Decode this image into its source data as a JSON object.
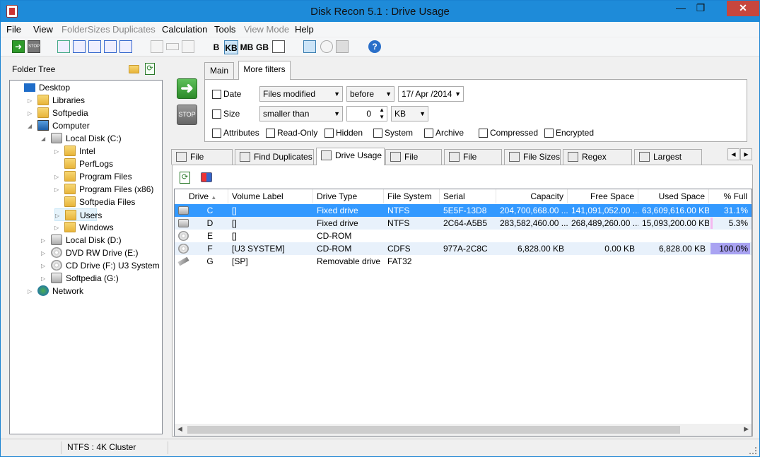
{
  "window": {
    "title": "Disk Recon 5.1 : Drive Usage"
  },
  "menu": [
    "File",
    "View",
    "FolderSizes",
    "Duplicates",
    "Calculation",
    "Tools",
    "View Mode",
    "Help"
  ],
  "menu_disabled": [
    false,
    false,
    true,
    true,
    false,
    false,
    true,
    false
  ],
  "toolbar": {
    "units": [
      "B",
      "KB",
      "MB",
      "GB"
    ],
    "active_unit": "KB"
  },
  "left": {
    "title": "Folder Tree",
    "tree": [
      {
        "label": "Desktop",
        "icon": "desktop-icon",
        "level": 0,
        "exp": ""
      },
      {
        "label": "Libraries",
        "icon": "folder-icon",
        "level": 1,
        "exp": "▷"
      },
      {
        "label": "Softpedia",
        "icon": "user-folder-icon",
        "level": 1,
        "exp": "▷"
      },
      {
        "label": "Computer",
        "icon": "computer-icon",
        "level": 1,
        "exp": "◢"
      },
      {
        "label": "Local Disk (C:)",
        "icon": "drive-icon",
        "level": 2,
        "exp": "◢"
      },
      {
        "label": "Intel",
        "icon": "folder-icon",
        "level": 3,
        "exp": "▷"
      },
      {
        "label": "PerfLogs",
        "icon": "folder-icon",
        "level": 3,
        "exp": ""
      },
      {
        "label": "Program Files",
        "icon": "folder-icon",
        "level": 3,
        "exp": "▷"
      },
      {
        "label": "Program Files (x86)",
        "icon": "folder-icon",
        "level": 3,
        "exp": "▷"
      },
      {
        "label": "Softpedia Files",
        "icon": "folder-icon",
        "level": 3,
        "exp": ""
      },
      {
        "label": "Users",
        "icon": "folder-icon",
        "level": 3,
        "exp": "▷",
        "selected": true
      },
      {
        "label": "Windows",
        "icon": "folder-icon",
        "level": 3,
        "exp": "▷"
      },
      {
        "label": "Local Disk (D:)",
        "icon": "drive-icon",
        "level": 2,
        "exp": "▷"
      },
      {
        "label": "DVD RW Drive (E:)",
        "icon": "dvd-icon",
        "level": 2,
        "exp": "▷"
      },
      {
        "label": "CD Drive (F:) U3 System",
        "icon": "cd-icon",
        "level": 2,
        "exp": "▷"
      },
      {
        "label": "Softpedia (G:)",
        "icon": "usb-drive-icon",
        "level": 2,
        "exp": "▷"
      },
      {
        "label": "Network",
        "icon": "network-icon",
        "level": 1,
        "exp": "▷"
      }
    ]
  },
  "filters": {
    "tabs": [
      "Main",
      "More filters"
    ],
    "date_label": "Date",
    "date_type": "Files modified",
    "date_cmp": "before",
    "date_value": "17/ Apr /2014",
    "size_label": "Size",
    "size_cmp": "smaller than",
    "size_value": "0",
    "size_unit": "KB",
    "attributes": [
      "Attributes",
      "Read-Only",
      "Hidden",
      "System",
      "Archive",
      "Compressed",
      "Encrypted"
    ]
  },
  "tabs": [
    "File Search",
    "Find Duplicates",
    "Drive Usage",
    "File Dates",
    "File Types",
    "File Sizes",
    "Regex Search",
    "Largest Files"
  ],
  "active_tab": "Drive Usage",
  "table": {
    "headers": [
      "Drive",
      "Volume Label",
      "Drive Type",
      "File System",
      "Serial",
      "Capacity",
      "Free Space",
      "Used Space",
      "% Full"
    ],
    "rows": [
      {
        "drive": "C",
        "label": "[]",
        "type": "Fixed drive",
        "fs": "NTFS",
        "serial": "5E5F-13D8",
        "capacity": "204,700,668.00 ...",
        "free": "141,091,052.00 ...",
        "used": "63,609,616.00 KB",
        "full": "31.1%",
        "pct": 31.1
      },
      {
        "drive": "D",
        "label": "[]",
        "type": "Fixed drive",
        "fs": "NTFS",
        "serial": "2C64-A5B5",
        "capacity": "283,582,460.00 ...",
        "free": "268,489,260.00 ...",
        "used": "15,093,200.00 KB",
        "full": "5.3%",
        "pct": 5.3
      },
      {
        "drive": "E",
        "label": "[]",
        "type": "CD-ROM",
        "fs": "",
        "serial": "",
        "capacity": "",
        "free": "",
        "used": "",
        "full": "",
        "pct": 0
      },
      {
        "drive": "F",
        "label": "[U3 SYSTEM]",
        "type": "CD-ROM",
        "fs": "CDFS",
        "serial": "977A-2C8C",
        "capacity": "6,828.00 KB",
        "free": "0.00 KB",
        "used": "6,828.00 KB",
        "full": "100.0%",
        "pct": 100
      },
      {
        "drive": "G",
        "label": "[SP]",
        "type": "Removable drive",
        "fs": "FAT32",
        "serial": "",
        "capacity": "",
        "free": "",
        "used": "",
        "full": "",
        "pct": 0
      }
    ]
  },
  "status": {
    "text": "NTFS : 4K Cluster"
  },
  "colors": {
    "selection": "#3399ff",
    "pct_low": "#f5b8f0",
    "pct_full": "#a9a3f2",
    "title_bg": "#1e8bd9"
  }
}
